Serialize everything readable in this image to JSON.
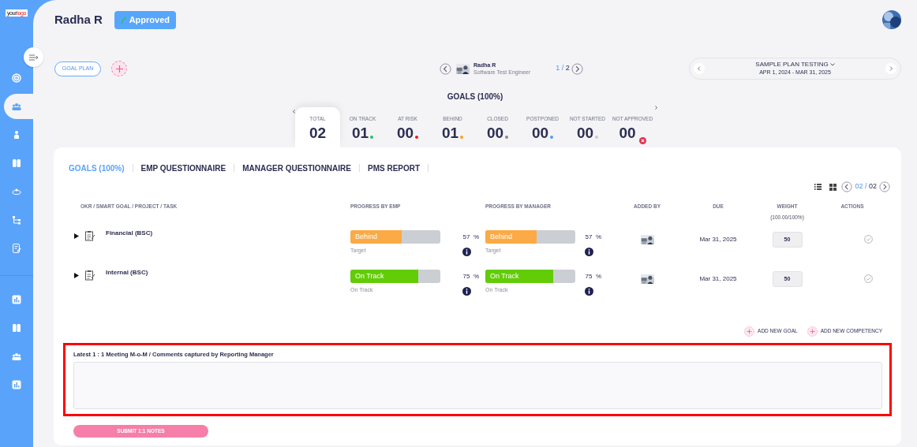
{
  "logo": {
    "parts": [
      "your",
      "logo"
    ]
  },
  "sidebar": {
    "items": [
      {
        "selected": false
      },
      {
        "selected": true
      },
      {
        "selected": false
      },
      {
        "selected": false
      },
      {
        "selected": false
      },
      {
        "selected": false
      },
      {
        "selected": false
      },
      {
        "selected": false
      },
      {
        "selected": false
      },
      {
        "selected": false
      },
      {
        "selected": false
      }
    ]
  },
  "header": {
    "name": "Radha R",
    "status": "Approved"
  },
  "goal_plan_button": "GOAL PLAN",
  "employee": {
    "name": "Radha R",
    "title": "Software Test Engineer",
    "page_current": "1",
    "page_separator": "/",
    "page_total": "2"
  },
  "plan": {
    "name": "SAMPLE PLAN TESTING",
    "dates": "APR 1, 2024 - MAR 31, 2025"
  },
  "goals_title": "GOALS (100%)",
  "stats": [
    {
      "label": "TOTAL",
      "value": "02",
      "selected": true,
      "kind": "plain"
    },
    {
      "label": "ON TRACK",
      "value": "01",
      "selected": false,
      "kind": "dot",
      "color": "#22c55e"
    },
    {
      "label": "AT RISK",
      "value": "00",
      "selected": false,
      "kind": "dot",
      "color": "#ef1c1c"
    },
    {
      "label": "BEHIND",
      "value": "01",
      "selected": false,
      "kind": "dot",
      "color": "#f7a21b"
    },
    {
      "label": "CLOSED",
      "value": "00",
      "selected": false,
      "kind": "dot",
      "color": "#8a8a8a"
    },
    {
      "label": "POSTPONED",
      "value": "00",
      "selected": false,
      "kind": "dot",
      "color": "#4f9ef8"
    },
    {
      "label": "NOT STARTED",
      "value": "00",
      "selected": false,
      "kind": "dot",
      "color": "#c9c9cf"
    },
    {
      "label": "NOT APPROVED",
      "value": "00",
      "selected": false,
      "kind": "error"
    }
  ],
  "tabs": [
    {
      "label": "GOALS (100%)",
      "selected": true
    },
    {
      "label": "EMP QUESTIONNAIRE",
      "selected": false
    },
    {
      "label": "MANAGER QUESTIONNAIRE",
      "selected": false
    },
    {
      "label": "PMS REPORT",
      "selected": false
    }
  ],
  "pager": {
    "current": "02",
    "separator": "/",
    "total": "02"
  },
  "table": {
    "columns": [
      {
        "label": "OKR / SMART GOAL / PROJECT / TASK"
      },
      {
        "label": "PROGRESS BY EMP"
      },
      {
        "label": "PROGRESS BY MANAGER"
      },
      {
        "label": "ADDED BY"
      },
      {
        "label": "DUE"
      },
      {
        "label": "WEIGHT",
        "sublabel": "(100.00/100%)"
      },
      {
        "label": "ACTIONS"
      }
    ],
    "rows": [
      {
        "name": "Financial (BSC)",
        "expanded": false,
        "emp": {
          "status": "Behind",
          "level": 0.57,
          "color": "#fbaa45",
          "note": "Target",
          "percent": "57  %"
        },
        "manager": {
          "status": "Behind",
          "level": 0.57,
          "color": "#fbaa45",
          "note": "Target",
          "percent": "57  %"
        },
        "due": "Mar 31, 2025",
        "weight": "50"
      },
      {
        "name": "Internal (BSC)",
        "expanded": false,
        "emp": {
          "status": "On Track",
          "level": 0.75,
          "color": "#62cc07",
          "note": "On Track",
          "percent": "75  %"
        },
        "manager": {
          "status": "On Track",
          "level": 0.75,
          "color": "#62cc07",
          "note": "On Track",
          "percent": "75  %"
        },
        "due": "Mar 31, 2025",
        "weight": "50"
      }
    ]
  },
  "add_buttons": [
    "ADD NEW GOAL",
    "ADD NEW COMPETENCY"
  ],
  "notes": {
    "label": "Latest 1 : 1 Meeting M-o-M / Comments captured by Reporting Manager",
    "highlighted": true,
    "submit": "SUBMIT 1:1 NOTES"
  }
}
